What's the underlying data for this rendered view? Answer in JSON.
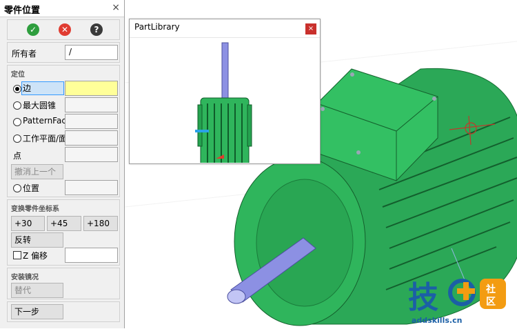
{
  "panel": {
    "title": "零件位置",
    "close": "×",
    "owner_label": "所有者",
    "owner_value": "/",
    "positioning": {
      "header": "定位",
      "edge_label": "边",
      "max_cone_label": "最大圆锥",
      "pattern_face_label": "PatternFace",
      "work_plane_label": "工作平面/面",
      "point_label": "点",
      "undo_last_label": "撤消上一个",
      "position_label": "位置"
    },
    "transform": {
      "header": "变换零件坐标系",
      "rot30": "+30",
      "rot45": "+45",
      "rot180": "+180",
      "flip": "反转",
      "z_offset_label": "Z 偏移"
    },
    "mount": {
      "header": "安装镜况",
      "replace": "替代"
    },
    "next_step": "下一步"
  },
  "part_library": {
    "title": "PartLibrary",
    "close": "×"
  },
  "watermark": {
    "big_text": "技",
    "badge_top": "社",
    "badge_bottom": "区",
    "url": "addskills.cn"
  },
  "colors": {
    "motor_green": "#2db35a",
    "shaft_blue": "#8a8fe0",
    "accent_red": "#c9302c",
    "highlight_yellow": "#ffff99"
  }
}
